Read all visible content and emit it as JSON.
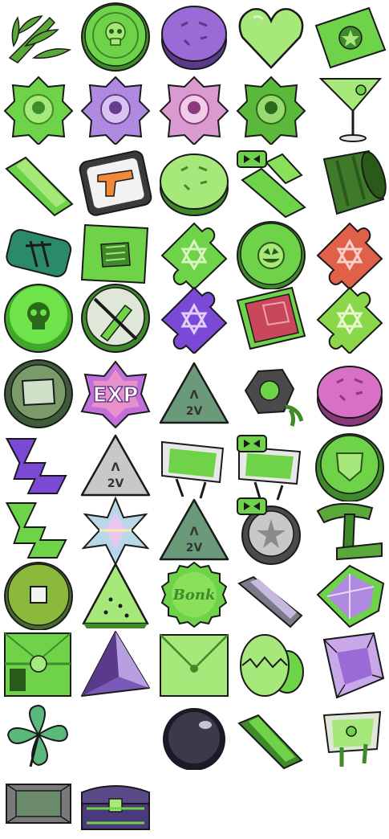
{
  "sheet": {
    "background": "#ffffff",
    "palette": {
      "green": "#6fd34a",
      "green_dark": "#3f8a2a",
      "green_light": "#a6e879",
      "purple": "#9a6ad6",
      "pink": "#d98ad6",
      "red": "#d9544a",
      "grey": "#9aa39a",
      "outline": "#1a1a1a"
    },
    "labels": {
      "exp_badge": "EXP",
      "tri_top": "Λ",
      "tri_bottom": "2V",
      "bottle_cap": "Bonk"
    },
    "rows": [
      [
        "wheat-icon",
        "skull-coin-icon",
        "purple-coin-icon",
        "heart-icon",
        "cash-bill-icon"
      ],
      [
        "green-badge-icon",
        "purple-badge-icon",
        "pink-badge-icon",
        "green-badge-icon-2",
        "cocktail-icon"
      ],
      [
        "green-crystal-icon",
        "pistol-card-icon",
        "green-disc-icon",
        "double-crystal-icon",
        "barrel-icon"
      ],
      [
        "battery-icon",
        "fist-card-icon",
        "green-puzzle-star-icon",
        "pumpkin-coin-icon",
        "red-puzzle-star-icon"
      ],
      [
        "skull-token-icon",
        "wrench-token-icon",
        "purple-puzzle-star-icon",
        "red-gem-card-icon",
        "green-puzzle-star-icon-2"
      ],
      [
        "screen-token-icon",
        "exp-star-badge-icon",
        "grey-triangle-icon",
        "grenade-icon",
        "pink-coin-icon"
      ],
      [
        "purple-bolt-icon",
        "silver-triangle-icon",
        "green-canister-icon",
        "double-canister-icon",
        "shield-coin-icon"
      ],
      [
        "green-bolt-icon",
        "prism-star-icon",
        "grey-triangle-icon-2",
        "silver-star-coin-icon",
        "green-hammer-icon"
      ],
      [
        "ancient-coin-icon",
        "watermelon-icon",
        "bottle-cap-icon",
        "purple-crystal-icon",
        "purple-gem-icon"
      ],
      [
        "green-box-icon",
        "purple-pyramid-icon",
        "envelope-icon",
        "green-egg-icon",
        "purple-orb-icon"
      ],
      [
        "clover-icon",
        "",
        "black-orb-icon",
        "green-shard-icon",
        "green-jar-icon"
      ],
      [
        "grey-plaque-icon",
        "treasure-chest-icon",
        "",
        "",
        ""
      ]
    ]
  }
}
